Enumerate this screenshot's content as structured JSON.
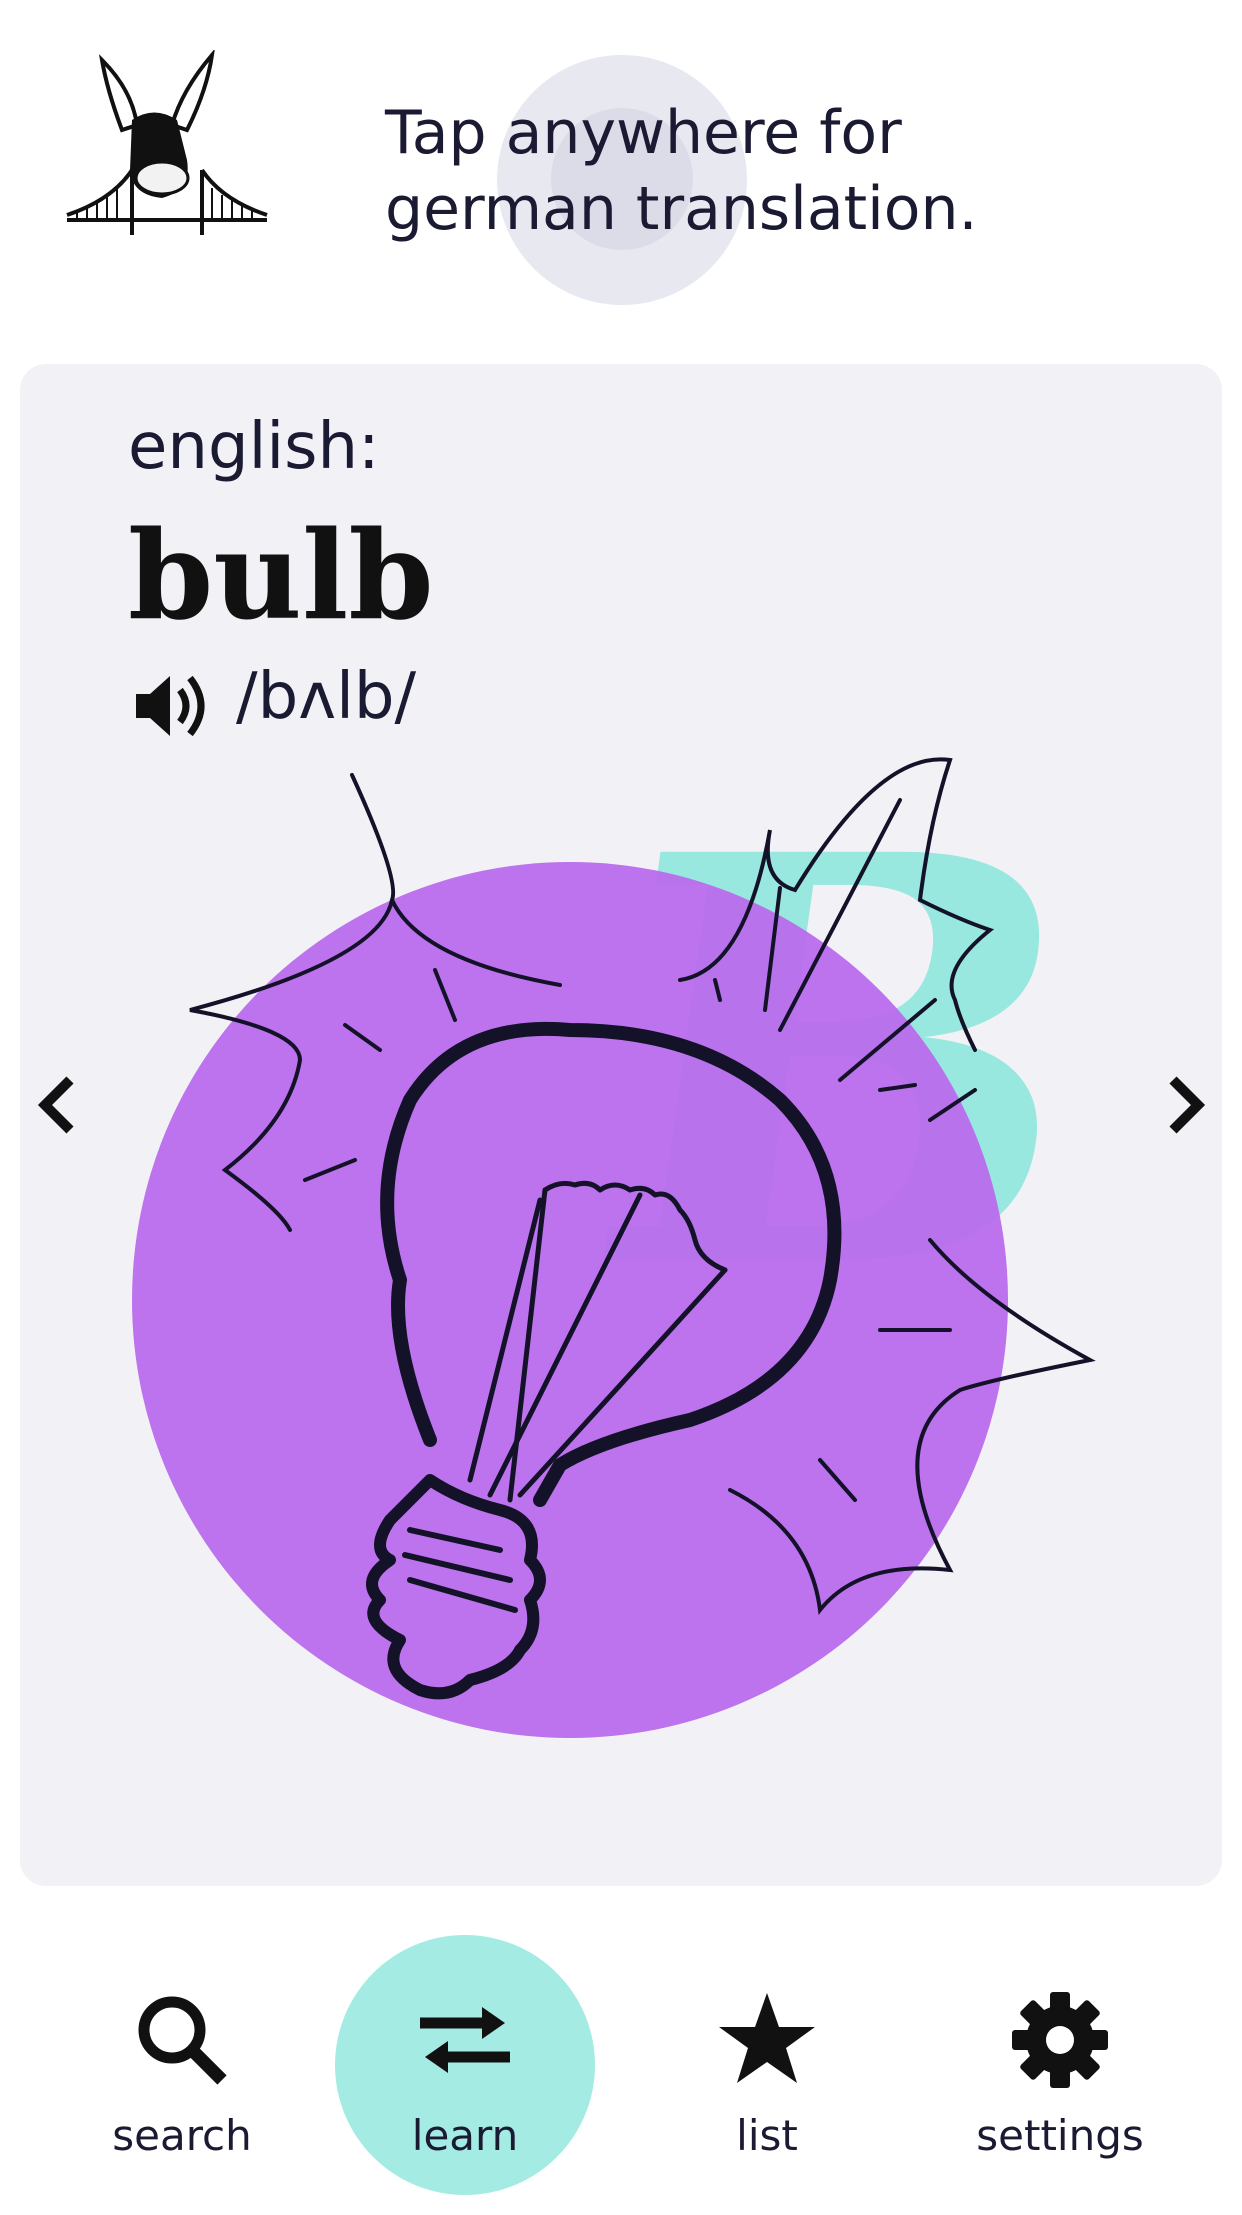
{
  "header": {
    "hint_line1": "Tap anywhere for",
    "hint_line2": "german translation.",
    "logo_icon": "donkey-logo-icon"
  },
  "card": {
    "language_label": "english:",
    "word": "bulb",
    "pronunciation": "/bʌlb/",
    "speaker_icon": "speaker-icon",
    "letter_decoration": "B",
    "colors": {
      "circle": "#b86bec",
      "letter": "#98e8e0",
      "card_bg": "#f2f1f6"
    }
  },
  "nav": {
    "items": [
      {
        "label": "search",
        "icon": "search-icon"
      },
      {
        "label": "learn",
        "icon": "swap-arrows-icon",
        "active": true
      },
      {
        "label": "list",
        "icon": "star-icon"
      },
      {
        "label": "settings",
        "icon": "gear-icon"
      }
    ],
    "active_color": "#a4ece3"
  }
}
